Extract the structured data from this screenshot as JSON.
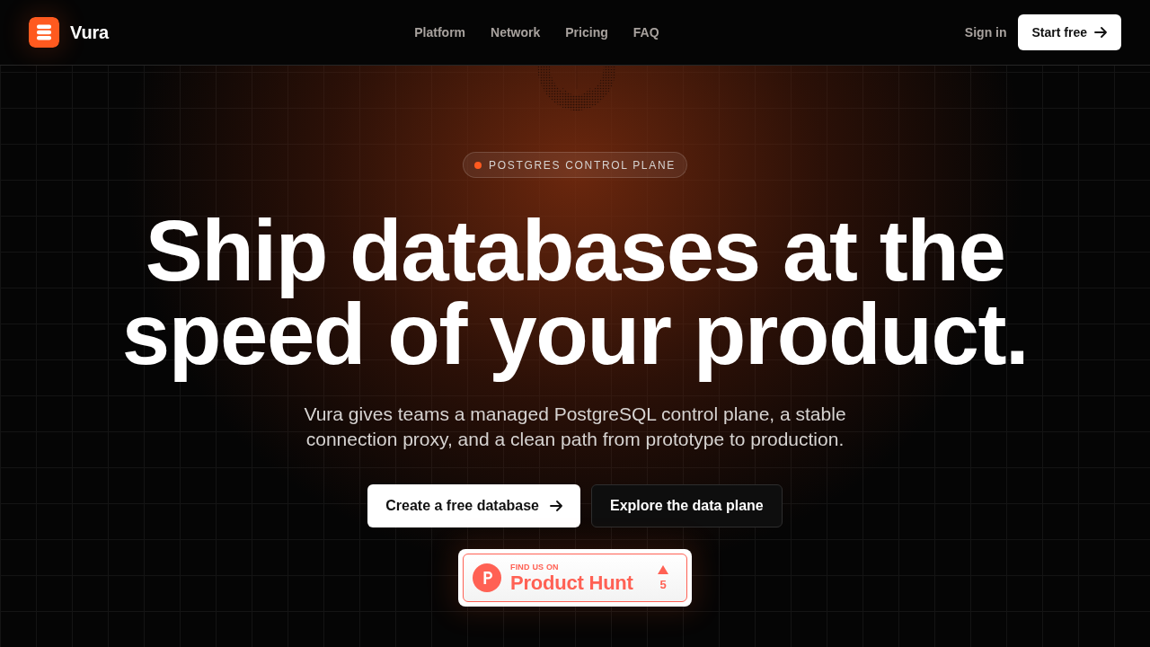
{
  "header": {
    "brand": "Vura",
    "nav": [
      {
        "label": "Platform"
      },
      {
        "label": "Network"
      },
      {
        "label": "Pricing"
      },
      {
        "label": "FAQ"
      }
    ],
    "sign_in": "Sign in",
    "cta": "Start free"
  },
  "hero": {
    "badge": "POSTGRES CONTROL PLANE",
    "headline_lines": [
      "Ship databases at the",
      "speed of your product."
    ],
    "description": "Vura gives teams a managed PostgreSQL control plane, a stable connection proxy, and a clean path from prototype to production.",
    "buttons": [
      {
        "label": "Create a free database",
        "kind": "primary"
      },
      {
        "label": "Explore the data plane",
        "kind": "secondary"
      }
    ],
    "product_hunt": {
      "eyebrow": "FIND US ON",
      "name": "Product Hunt",
      "votes": "5"
    }
  }
}
